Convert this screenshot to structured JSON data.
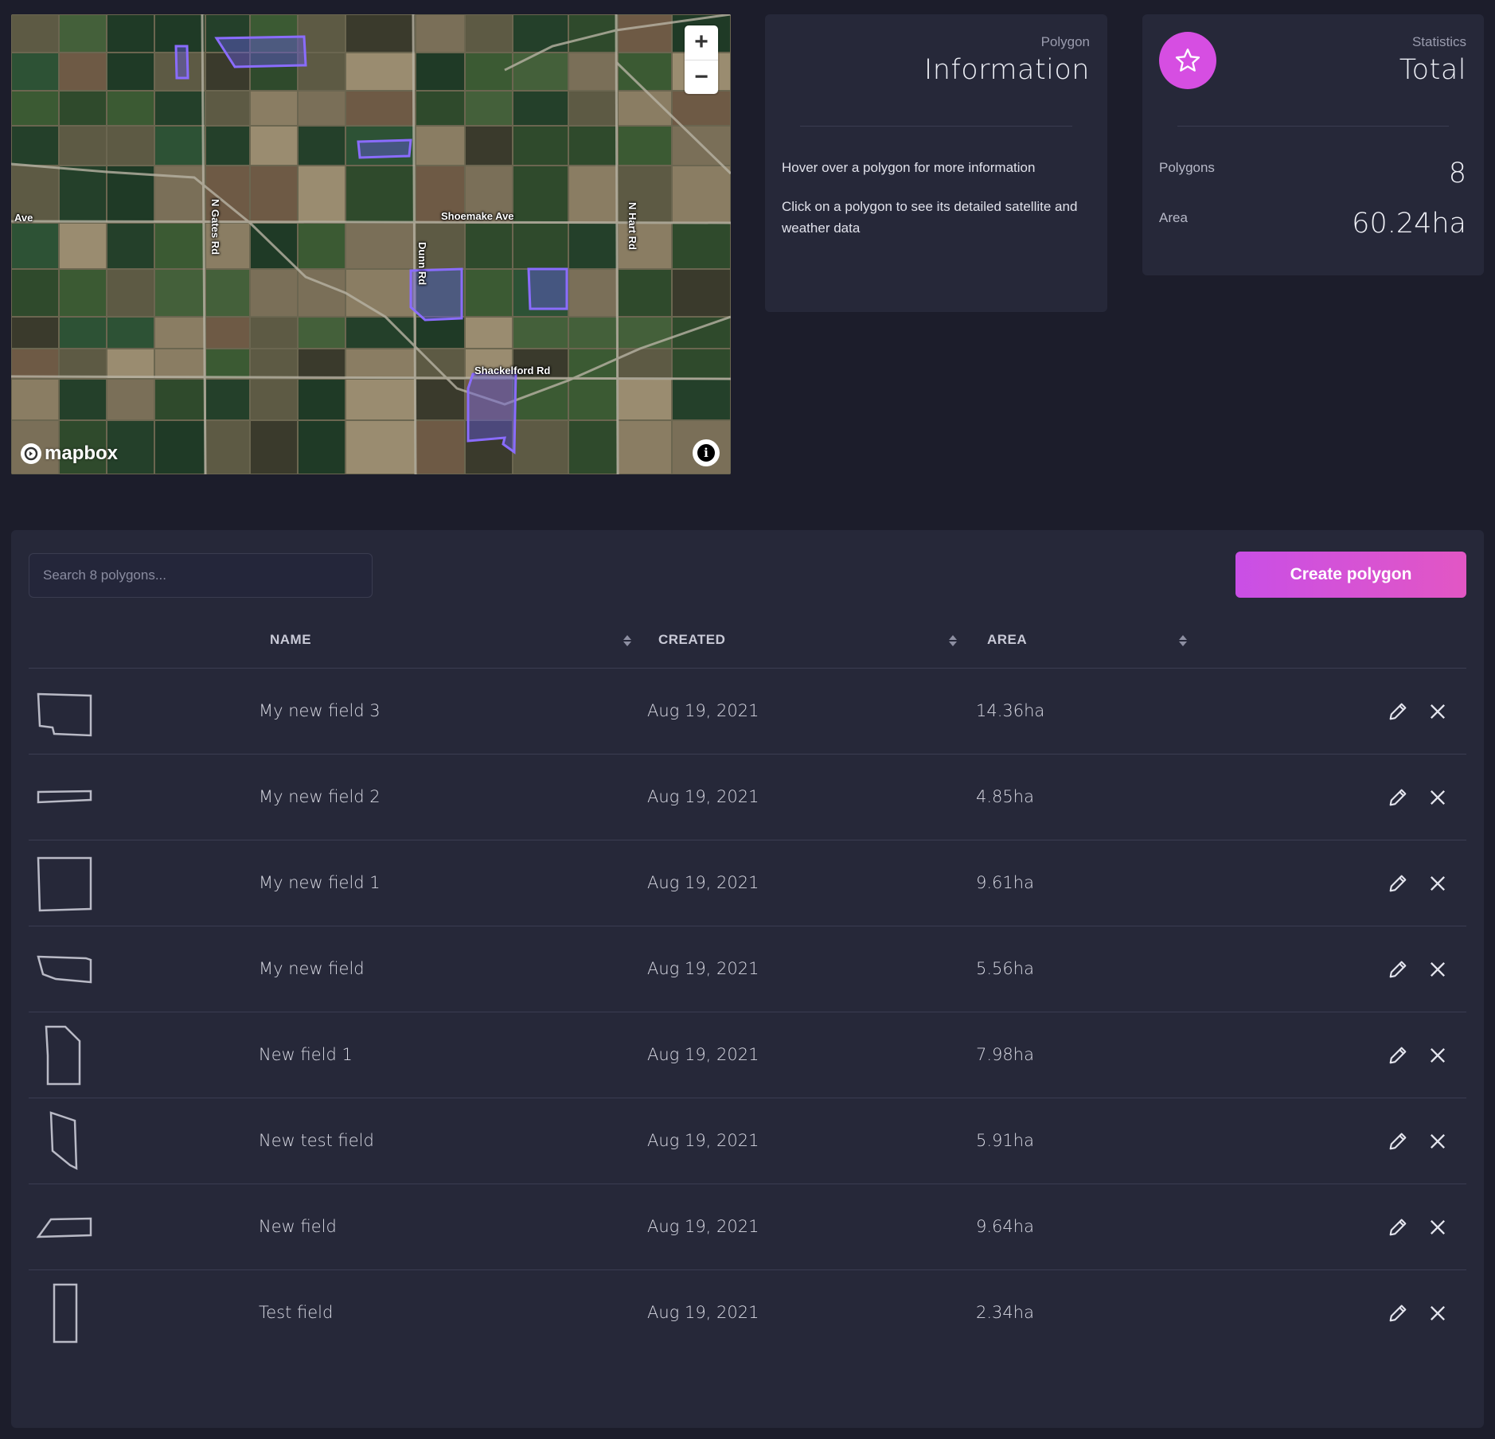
{
  "map": {
    "road_labels": {
      "ave_left": "Ave",
      "n_gates": "N Gates Rd",
      "dunn": "Dunn Rd",
      "shoemake": "Shoemake Ave",
      "n_hart": "N Hart Rd",
      "shackelford": "Shackelford Rd"
    },
    "zoom_in_label": "+",
    "zoom_out_label": "−",
    "attribution_logo": "mapbox",
    "info_label": "i",
    "polygon_color": "#7b5cf5"
  },
  "info_card": {
    "subtitle": "Polygon",
    "title": "Information",
    "line1": "Hover over a polygon for more information",
    "line2": "Click on a polygon to see its detailed satellite and weather data"
  },
  "stats_card": {
    "subtitle": "Statistics",
    "title": "Total",
    "icon": "star-icon",
    "accent": "#d64ee2",
    "polygons_label": "Polygons",
    "polygons_value": "8",
    "area_label": "Area",
    "area_value": "60.24ha"
  },
  "table": {
    "search_placeholder": "Search 8 polygons...",
    "create_button": "Create polygon",
    "headers": {
      "name": "NAME",
      "created": "CREATED",
      "area": "AREA"
    },
    "rows": [
      {
        "name": "My new field 3",
        "created": "Aug 19, 2021",
        "area": "14.36ha"
      },
      {
        "name": "My new field 2",
        "created": "Aug 19, 2021",
        "area": "4.85ha"
      },
      {
        "name": "My new field 1",
        "created": "Aug 19, 2021",
        "area": "9.61ha"
      },
      {
        "name": "My new field",
        "created": "Aug 19, 2021",
        "area": "5.56ha"
      },
      {
        "name": "New field 1",
        "created": "Aug 19, 2021",
        "area": "7.98ha"
      },
      {
        "name": "New test field",
        "created": "Aug 19, 2021",
        "area": "5.91ha"
      },
      {
        "name": "New field",
        "created": "Aug 19, 2021",
        "area": "9.64ha"
      },
      {
        "name": "Test field",
        "created": "Aug 19, 2021",
        "area": "2.34ha"
      }
    ]
  }
}
